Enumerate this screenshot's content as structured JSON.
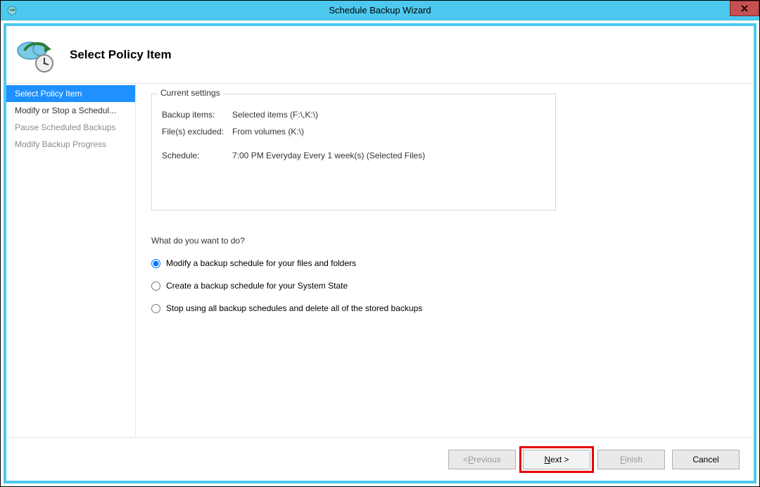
{
  "window": {
    "title": "Schedule Backup Wizard"
  },
  "header": {
    "heading": "Select Policy Item"
  },
  "nav": {
    "items": [
      {
        "label": "Select Policy Item",
        "selected": true,
        "disabled": false
      },
      {
        "label": "Modify or Stop a Schedul...",
        "selected": false,
        "disabled": false
      },
      {
        "label": "Pause Scheduled Backups",
        "selected": false,
        "disabled": true
      },
      {
        "label": "Modify Backup Progress",
        "selected": false,
        "disabled": true
      }
    ]
  },
  "settings": {
    "legend": "Current settings",
    "rows": {
      "backup_items_label": "Backup items:",
      "backup_items_value": "Selected items (F:\\,K:\\)",
      "files_excluded_label": "File(s) excluded:",
      "files_excluded_value": "From volumes (K:\\)",
      "schedule_label": "Schedule:",
      "schedule_value": "7:00 PM Everyday Every 1 week(s) (Selected Files)"
    }
  },
  "question": "What do you want to do?",
  "options": [
    {
      "label": "Modify a backup schedule for your files and folders",
      "checked": true
    },
    {
      "label": "Create a backup schedule for your System State",
      "checked": false
    },
    {
      "label": "Stop using all backup schedules and delete all of the stored backups",
      "checked": false
    }
  ],
  "buttons": {
    "previous_prefix": "< ",
    "previous_mnemonic": "P",
    "previous_suffix": "revious",
    "next_mnemonic": "N",
    "next_suffix": "ext >",
    "finish_mnemonic": "F",
    "finish_suffix": "inish",
    "cancel": "Cancel"
  }
}
